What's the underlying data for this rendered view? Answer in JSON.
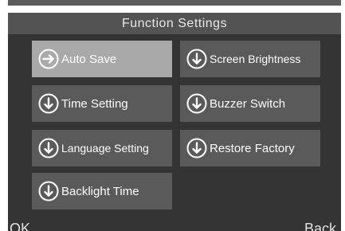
{
  "header": {
    "title": "Function Settings"
  },
  "menu": {
    "items": [
      {
        "label": "Auto Save",
        "icon": "arrow-right-circle-icon",
        "selected": true
      },
      {
        "label": "Screen Brightness",
        "icon": "arrow-down-circle-icon",
        "selected": false
      },
      {
        "label": "Time Setting",
        "icon": "arrow-down-circle-icon",
        "selected": false
      },
      {
        "label": "Buzzer Switch",
        "icon": "arrow-down-circle-icon",
        "selected": false
      },
      {
        "label": "Language Setting",
        "icon": "arrow-down-circle-icon",
        "selected": false
      },
      {
        "label": "Restore Factory",
        "icon": "arrow-down-circle-icon",
        "selected": false
      },
      {
        "label": "Backlight Time",
        "icon": "arrow-down-circle-icon",
        "selected": false
      }
    ]
  },
  "softkeys": {
    "left_label": "OK",
    "right_label": "Back"
  },
  "colors": {
    "screen_background": "#343434",
    "title_bar": "#535353",
    "button": "#5a5a5a",
    "button_selected": "#a9a9a9",
    "text": "#ffffff"
  }
}
